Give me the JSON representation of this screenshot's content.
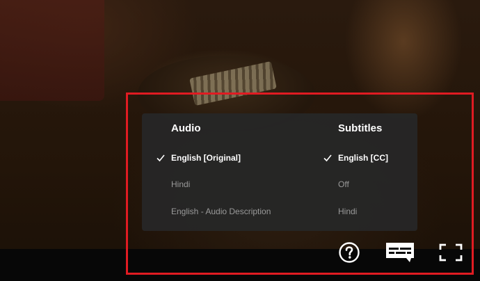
{
  "audio": {
    "title": "Audio",
    "options": [
      {
        "label": "English [Original]",
        "selected": true
      },
      {
        "label": "Hindi",
        "selected": false
      },
      {
        "label": "English - Audio Description",
        "selected": false
      }
    ]
  },
  "subtitles": {
    "title": "Subtitles",
    "options": [
      {
        "label": "English [CC]",
        "selected": true
      },
      {
        "label": "Off",
        "selected": false
      },
      {
        "label": "Hindi",
        "selected": false
      }
    ]
  },
  "controls": {
    "help_icon": "question-circle-icon",
    "subtitles_icon": "subtitles-speech-bubble-icon",
    "fullscreen_icon": "fullscreen-corners-icon"
  },
  "colors": {
    "highlight": "#e01b22",
    "panel": "#262626",
    "selected_text": "#ffffff",
    "unselected_text": "#9a9a9a"
  }
}
